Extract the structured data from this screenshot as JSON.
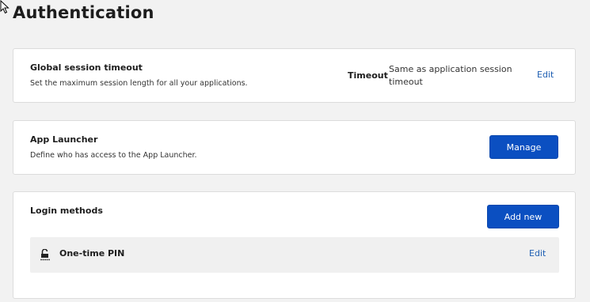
{
  "page": {
    "title": "Authentication"
  },
  "session_timeout": {
    "title": "Global session timeout",
    "description": "Set the maximum session length for all your applications.",
    "label": "Timeout",
    "value": "Same as application session timeout",
    "edit_label": "Edit"
  },
  "app_launcher": {
    "title": "App Launcher",
    "description": "Define who has access to the App Launcher.",
    "button_label": "Manage"
  },
  "login_methods": {
    "title": "Login methods",
    "add_button_label": "Add new",
    "methods": [
      {
        "label": "One-time PIN",
        "icon": "unlock-pin-icon",
        "edit_label": "Edit"
      }
    ]
  },
  "colors": {
    "primary": "#0b4fc1",
    "link": "#1f5fb3",
    "background": "#f2f2f2"
  }
}
